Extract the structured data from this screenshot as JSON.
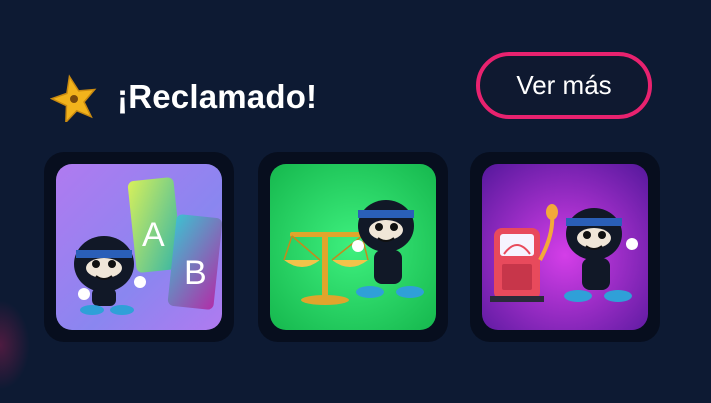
{
  "header": {
    "title": "¡Reclamado!",
    "more_button_label": "Ver más",
    "star_icon": "star-icon"
  },
  "cards": [
    {
      "icon": "ninja-ab-test-illustration",
      "bg_from": "#a77cf2",
      "bg_to": "#3fb8d6"
    },
    {
      "icon": "ninja-scale-illustration",
      "bg_from": "#22c25a",
      "bg_to": "#2ee06e"
    },
    {
      "icon": "ninja-fuel-pump-illustration",
      "bg_from": "#9b2fd6",
      "bg_to": "#5a1aa8"
    }
  ],
  "colors": {
    "background": "#0d1a33",
    "button_border": "#e8226f",
    "star": "#f2b31c"
  },
  "ab_letters": {
    "a": "A",
    "b": "B"
  }
}
